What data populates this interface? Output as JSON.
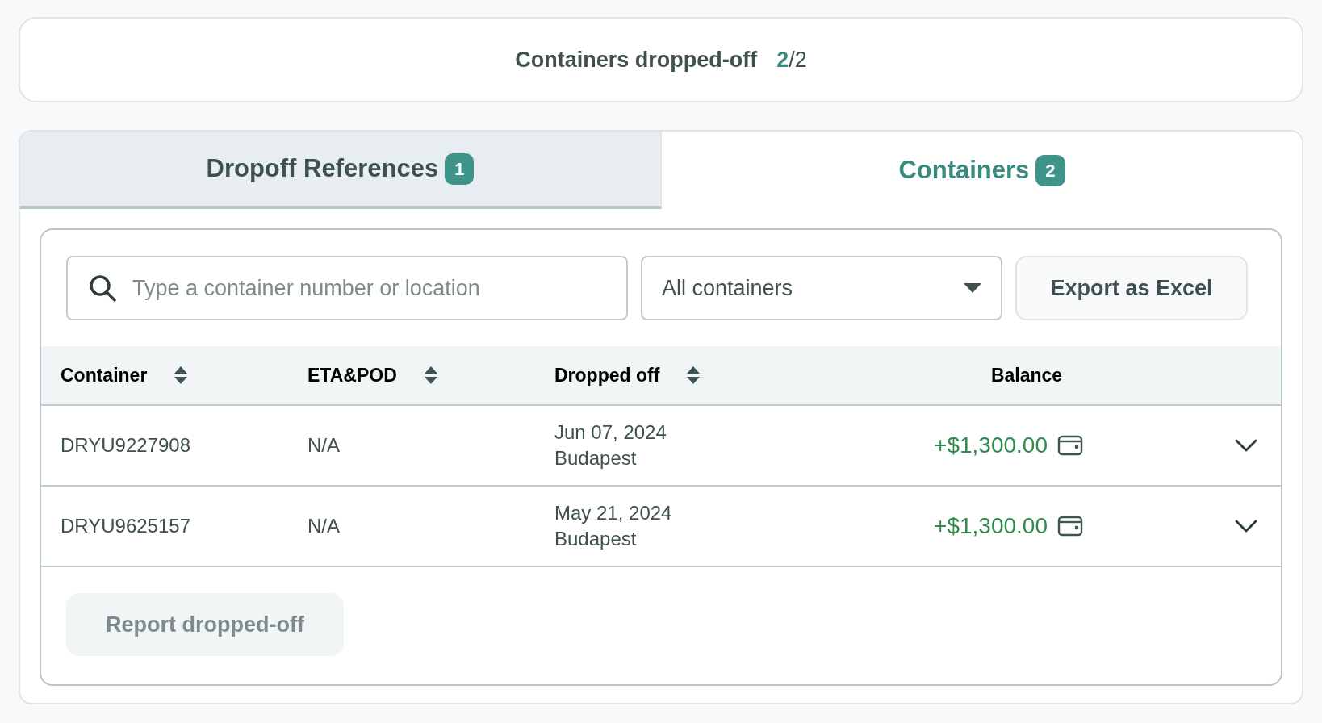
{
  "summary": {
    "label": "Containers dropped-off",
    "done": "2",
    "total": "/2"
  },
  "tabs": [
    {
      "label": "Dropoff References",
      "count": "1",
      "selected": false
    },
    {
      "label": "Containers",
      "count": "2",
      "selected": true
    }
  ],
  "search": {
    "placeholder": "Type a container number or location"
  },
  "filter": {
    "value": "All containers"
  },
  "export_button": "Export as Excel",
  "table": {
    "columns": [
      {
        "label": "Container",
        "sortable": true
      },
      {
        "label": "ETA&POD",
        "sortable": true
      },
      {
        "label": "Dropped off",
        "sortable": true
      },
      {
        "label": "Balance",
        "sortable": false
      }
    ],
    "rows": [
      {
        "container": "DRYU9227908",
        "eta_pod": "N/A",
        "date": "Jun 07, 2024",
        "place": "Budapest",
        "balance": "+$1,300.00",
        "expanded": false
      },
      {
        "container": "DRYU9625157",
        "eta_pod": "N/A",
        "date": "May 21, 2024",
        "place": "Budapest",
        "balance": "+$1,300.00",
        "expanded": false
      }
    ]
  },
  "report_button": {
    "label": "Report dropped-off",
    "disabled": true
  }
}
